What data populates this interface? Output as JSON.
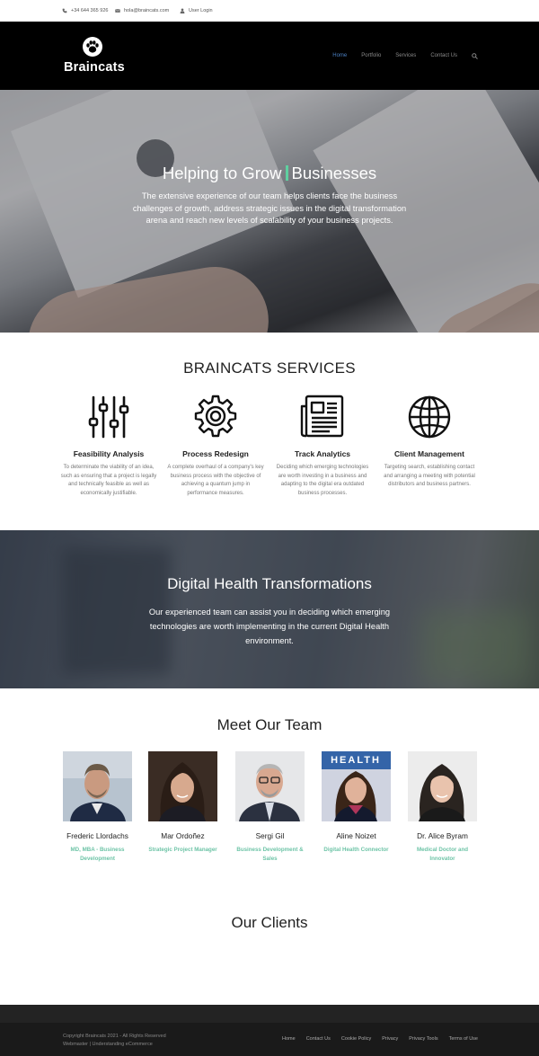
{
  "topbar": {
    "phone": "+34 644 365 926",
    "email": "hola@braincats.com",
    "login": "User Login"
  },
  "header": {
    "brand": "Braincats",
    "nav": [
      "Home",
      "Portfolio",
      "Services",
      "Contact Us"
    ],
    "active_color": "#4a7fc1"
  },
  "hero": {
    "title_part1": "Helping to Grow",
    "title_part2": "Businesses",
    "text": "The extensive experience of our team helps clients face the business challenges of growth, address strategic issues in the digital transformation arena and reach new levels of scalability of your business projects."
  },
  "services": {
    "title": "BRAINCATS SERVICES",
    "items": [
      {
        "icon": "sliders-icon",
        "title": "Feasibility Analysis",
        "desc": "To determinate the viability of an idea, such as ensuring that a project is legally and technically feasible as well as economically justifiable."
      },
      {
        "icon": "gear-icon",
        "title": "Process Redesign",
        "desc": "A complete overhaul of a company's key business process with the objective of achieving a quantum jump in performance measures."
      },
      {
        "icon": "newspaper-icon",
        "title": "Track Analytics",
        "desc": "Deciding which emerging technologies are worth investing in a business and adapting to the digital era outdated business processes."
      },
      {
        "icon": "globe-icon",
        "title": "Client Management",
        "desc": "Targeting search, establishing contact and arranging a meeting with potential distributors and business partners."
      }
    ]
  },
  "digital_health": {
    "title": "Digital Health Transformations",
    "text": "Our experienced team can assist you in deciding which emerging technologies are worth implementing in the current Digital Health environment."
  },
  "team": {
    "title": "Meet Our Team",
    "members": [
      {
        "name": "Frederic Llordachs",
        "role": "MD, MBA - Business Development"
      },
      {
        "name": "Mar Ordoñez",
        "role": "Strategic Project Manager"
      },
      {
        "name": "Sergi Gil",
        "role": "Business Development & Sales"
      },
      {
        "name": "Aline Noizet",
        "role": "Digital Health Connector"
      },
      {
        "name": "Dr. Alice Byram",
        "role": "Medical Doctor and Innovator"
      }
    ],
    "role_color": "#6ec4a7",
    "photo_text": "HEALTH"
  },
  "clients": {
    "title": "Our Clients"
  },
  "footer": {
    "copyright": "Copyright Braincats 2021 - All Rights Reserved",
    "webmaster": "Webmaster | Understanding eCommerce",
    "links": [
      "Home",
      "Contact Us",
      "Cookie Policy",
      "Privacy",
      "Privacy Tools",
      "Terms of Use"
    ]
  }
}
